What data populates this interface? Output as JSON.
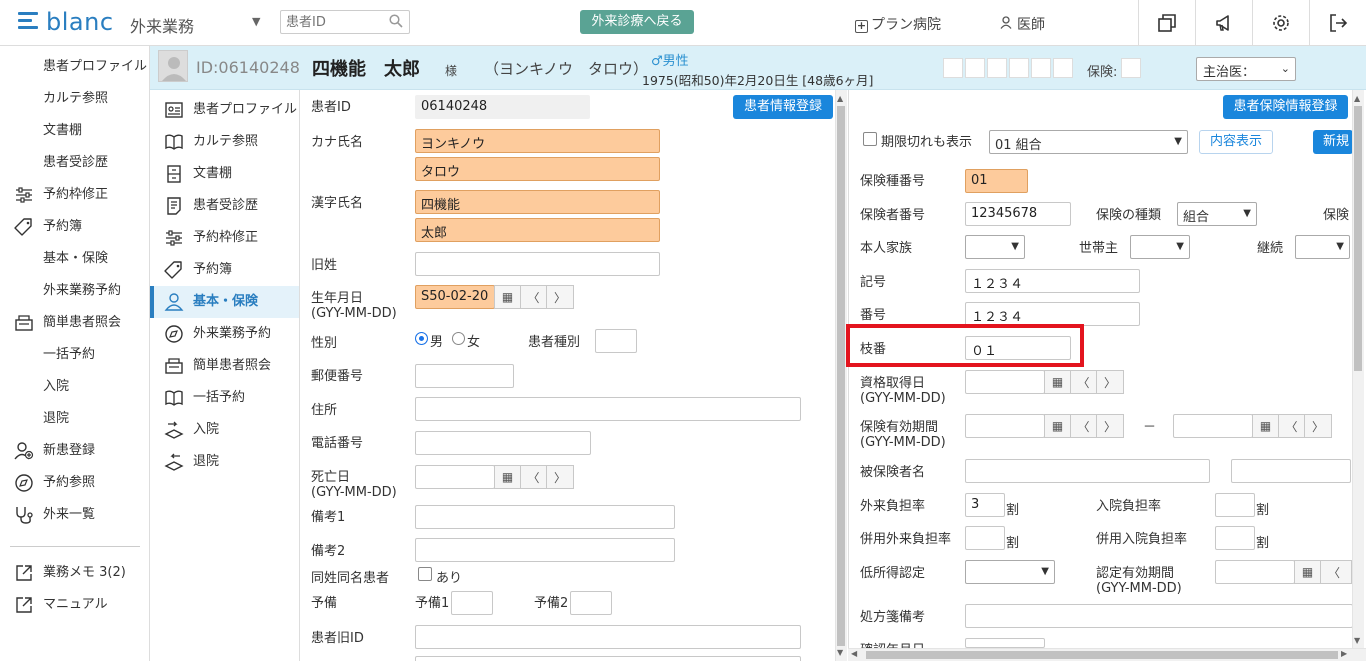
{
  "topbar": {
    "logo": "blanc",
    "mode": "外来業務",
    "search_placeholder": "患者ID",
    "back_button": "外来診療へ戻る",
    "hospital": "プラン病院",
    "doctor": "医師"
  },
  "patient": {
    "id": "ID:06140248",
    "name": "四機能　太郎",
    "sama": "様",
    "kana": "（ヨンキノウ　タロウ）",
    "sex": "男性",
    "birth": "1975(昭和50)年2月20日生 [48歳6ヶ月]",
    "hoken_label": "保険:",
    "doctor_select": "主治医："
  },
  "leftnav": [
    {
      "label": "患者プロファイル",
      "icon": "none"
    },
    {
      "label": "カルテ参照",
      "icon": "none"
    },
    {
      "label": "文書棚",
      "icon": "none"
    },
    {
      "label": "患者受診歴",
      "icon": "none"
    },
    {
      "label": "予約枠修正",
      "icon": "sliders-icon"
    },
    {
      "label": "予約簿",
      "icon": "tag-icon"
    },
    {
      "label": "基本・保険",
      "icon": "none"
    },
    {
      "label": "外来業務予約",
      "icon": "none"
    },
    {
      "label": "簡単患者照会",
      "icon": "register-icon"
    },
    {
      "label": "一括予約",
      "icon": "none"
    },
    {
      "label": "入院",
      "icon": "none"
    },
    {
      "label": "退院",
      "icon": "none"
    },
    {
      "label": "新患登録",
      "icon": "user-add-icon"
    },
    {
      "label": "予約参照",
      "icon": "compass-icon"
    },
    {
      "label": "外来一覧",
      "icon": "stethoscope-icon"
    },
    {
      "label": "業務メモ 3(2)",
      "icon": "external-link-icon"
    },
    {
      "label": "マニュアル",
      "icon": "external-link-icon"
    }
  ],
  "subnav": [
    "患者プロファイル",
    "カルテ参照",
    "文書棚",
    "患者受診歴",
    "予約枠修正",
    "予約簿",
    "基本・保険",
    "外来業務予約",
    "簡単患者照会",
    "一括予約",
    "入院",
    "退院"
  ],
  "form": {
    "register_button": "患者情報登録",
    "patient_id_label": "患者ID",
    "patient_id": "06140248",
    "kana_label": "カナ氏名",
    "kana_sei": "ヨンキノウ",
    "kana_mei": "タロウ",
    "kanji_label": "漢字氏名",
    "kanji_sei": "四機能",
    "kanji_mei": "太郎",
    "old_surname_label": "旧姓",
    "birth_label": "生年月日",
    "birth_format": "(GYY-MM-DD)",
    "birth": "S50-02-20",
    "sex_label": "性別",
    "male": "男",
    "female": "女",
    "patient_type_label": "患者種別",
    "postal_label": "郵便番号",
    "address_label": "住所",
    "phone_label": "電話番号",
    "death_label": "死亡日",
    "death_format": "(GYY-MM-DD)",
    "note1_label": "備考1",
    "note2_label": "備考2",
    "same_name_label": "同姓同名患者",
    "same_name_check": "あり",
    "spare_label": "予備",
    "spare1": "予備1",
    "spare2": "予備2",
    "old_id_label": "患者旧ID"
  },
  "insurance": {
    "register_button": "患者保険情報登録",
    "expired_check": "期限切れも表示",
    "select": "01 組合",
    "detail_button": "内容表示",
    "new_button": "新規",
    "type_no_label": "保険種番号",
    "type_no": "01",
    "insurer_no_label": "保険者番号",
    "insurer_no": "12345678",
    "kind_label": "保険の種類",
    "kind": "組合",
    "hoken_cut": "保険",
    "honnin_label": "本人家族",
    "setai_label": "世帯主",
    "keizoku_label": "継続",
    "kigo_label": "記号",
    "kigo": "１２３４",
    "bango_label": "番号",
    "bango": "１２３４",
    "edaban_label": "枝番",
    "edaban": "０１",
    "shikaku_label": "資格取得日",
    "shikaku_format": "(GYY-MM-DD)",
    "yuko_label": "保険有効期間",
    "yuko_format": "(GYY-MM-DD)",
    "dash": "－",
    "hihoken_label": "被保険者名",
    "gairai_label": "外来負担率",
    "gairai": "3",
    "wari": "割",
    "nyuin_label": "入院負担率",
    "heiyo_gairai_label": "併用外来負担率",
    "heiyo_nyuin_label": "併用入院負担率",
    "teishotoku_label": "低所得認定",
    "nintei_label": "認定有効期間",
    "nintei_format": "(GYY-MM-DD)",
    "shohosen_label": "処方箋備考",
    "kakunin_label": "確認年月日"
  }
}
